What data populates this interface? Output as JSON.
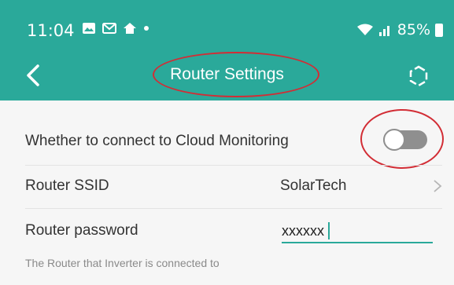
{
  "status_bar": {
    "time": "11:04",
    "battery_percent": "85%",
    "icons": [
      "gallery-icon",
      "mail-icon",
      "home-icon",
      "dot-icon",
      "wifi-icon",
      "signal-icon",
      "battery-icon"
    ]
  },
  "app_bar": {
    "title": "Router Settings",
    "background_color": "#2aa99a"
  },
  "settings": {
    "cloud_monitoring": {
      "label": "Whether to connect to Cloud Monitoring",
      "enabled": false
    },
    "router_ssid": {
      "label": "Router SSID",
      "value": "SolarTech"
    },
    "router_password": {
      "label": "Router password",
      "value": "xxxxxx"
    },
    "hint": "The Router that Inverter is connected to"
  },
  "annotation_color": "#d22d35"
}
